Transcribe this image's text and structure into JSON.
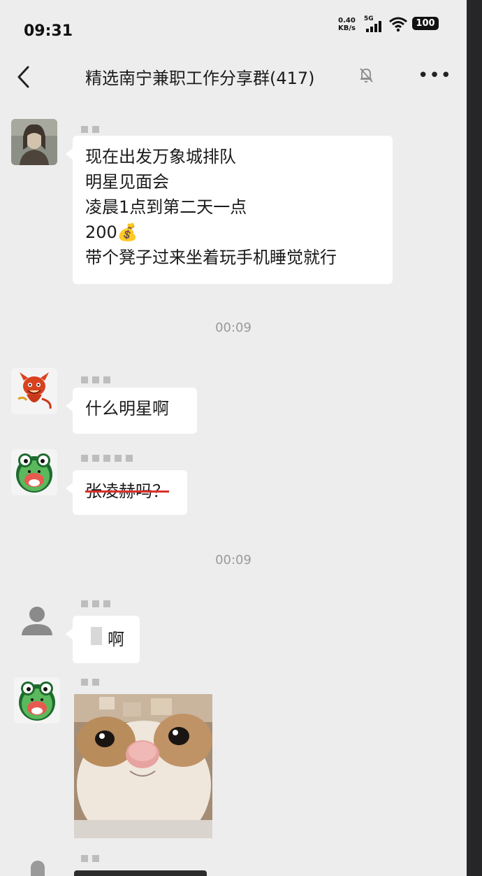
{
  "status": {
    "time": "09:31",
    "net_speed": "0.40",
    "net_unit": "KB/s",
    "network": "5G",
    "battery": "100"
  },
  "header": {
    "title": "精选南宁兼职工作分享群(417)"
  },
  "messages": {
    "m1": {
      "lines": [
        "现在出发万象城排队",
        "明星见面会",
        "凌晨1点到第二天一点",
        "200💰",
        "带个凳子过来坐着玩手机睡觉就行"
      ]
    },
    "ts1": "00:09",
    "m2": {
      "text": "什么明星啊"
    },
    "m3": {
      "text": "张凌赫吗？"
    },
    "ts2": "00:09",
    "m4": {
      "text": "啊"
    }
  },
  "colors": {
    "background": "#ededed",
    "bubble": "#ffffff",
    "strike": "#d9302c",
    "timestamp": "#9a9a9a"
  }
}
